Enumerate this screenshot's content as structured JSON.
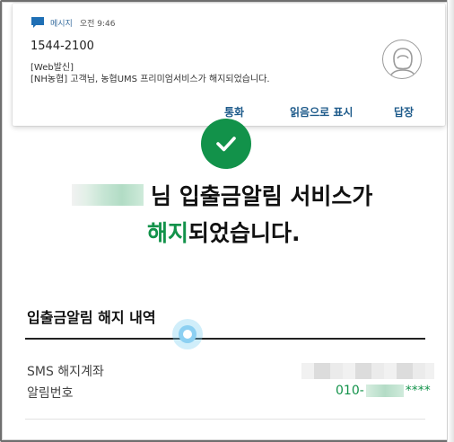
{
  "notification": {
    "app_name": "메시지",
    "time": "오전 9:46",
    "sender": "1544-2100",
    "line1": "[Web발신]",
    "line2": "[NH농협] 고객님, 농협UMS 프리미엄서비스가 해지되었습니다.",
    "actions": {
      "call": "통화",
      "mark_read": "읽음으로 표시",
      "reply": "답장"
    }
  },
  "main": {
    "title_suffix": "님 입출금알림 서비스가",
    "title_highlight": "해지",
    "title_line2_rest": "되었습니다.",
    "section_title": "입출금알림 해지 내역",
    "rows": {
      "account_label": "SMS 해지계좌",
      "phone_label": "알림번호",
      "phone_prefix": "010-",
      "phone_suffix": "****"
    }
  },
  "colors": {
    "accent_green": "#12924a",
    "action_blue": "#1d5a8a",
    "message_icon": "#1f6fb5"
  },
  "icons": {
    "message": "message-bubble-icon",
    "avatar": "person-avatar-icon",
    "check": "check-icon"
  }
}
